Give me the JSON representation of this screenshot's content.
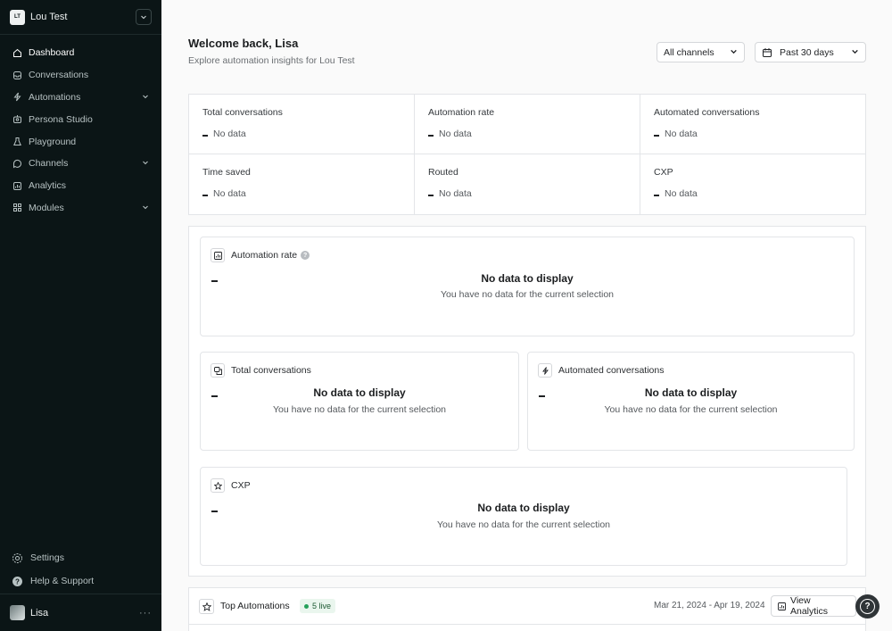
{
  "workspace": {
    "initials": "LT",
    "name": "Lou Test"
  },
  "sidebar": {
    "items": [
      {
        "label": "Dashboard",
        "icon": "home-icon",
        "active": true
      },
      {
        "label": "Conversations",
        "icon": "inbox-icon"
      },
      {
        "label": "Automations",
        "icon": "bolt-icon",
        "expandable": true
      },
      {
        "label": "Persona Studio",
        "icon": "persona-icon"
      },
      {
        "label": "Playground",
        "icon": "flask-icon"
      },
      {
        "label": "Channels",
        "icon": "channels-icon",
        "expandable": true
      },
      {
        "label": "Analytics",
        "icon": "chart-icon"
      },
      {
        "label": "Modules",
        "icon": "modules-icon",
        "expandable": true
      }
    ],
    "footer": [
      {
        "label": "Settings",
        "icon": "gear-icon"
      },
      {
        "label": "Help & Support",
        "icon": "help-icon"
      }
    ],
    "user": {
      "name": "Lisa",
      "more": "···"
    }
  },
  "header": {
    "greeting": "Welcome back, Lisa",
    "subtitle": "Explore automation insights for Lou Test",
    "channel_filter": "All channels",
    "date_filter": "Past 30 days"
  },
  "stats": [
    {
      "label": "Total conversations",
      "value": "No data"
    },
    {
      "label": "Automation rate",
      "value": "No data"
    },
    {
      "label": "Automated conversations",
      "value": "No data"
    },
    {
      "label": "Time saved",
      "value": "No data"
    },
    {
      "label": "Routed",
      "value": "No data"
    },
    {
      "label": "CXP",
      "value": "No data"
    }
  ],
  "cards": {
    "automation_rate": {
      "title": "Automation rate",
      "empty_title": "No data to display",
      "empty_sub": "You have no data for the current selection"
    },
    "total_conversations": {
      "title": "Total conversations",
      "empty_title": "No data to display",
      "empty_sub": "You have no data for the current selection"
    },
    "automated_conversations": {
      "title": "Automated conversations",
      "empty_title": "No data to display",
      "empty_sub": "You have no data for the current selection"
    },
    "cxp": {
      "title": "CXP",
      "empty_title": "No data to display",
      "empty_sub": "You have no data for the current selection"
    }
  },
  "top_automations": {
    "title": "Top Automations",
    "live_badge": "5 live",
    "date_range": "Mar 21, 2024 - Apr 19, 2024",
    "view_button": "View Analytics"
  },
  "colors": {
    "sidebar_bg": "#0b1516",
    "live_green": "#25a15a",
    "background": "#fafafa"
  }
}
